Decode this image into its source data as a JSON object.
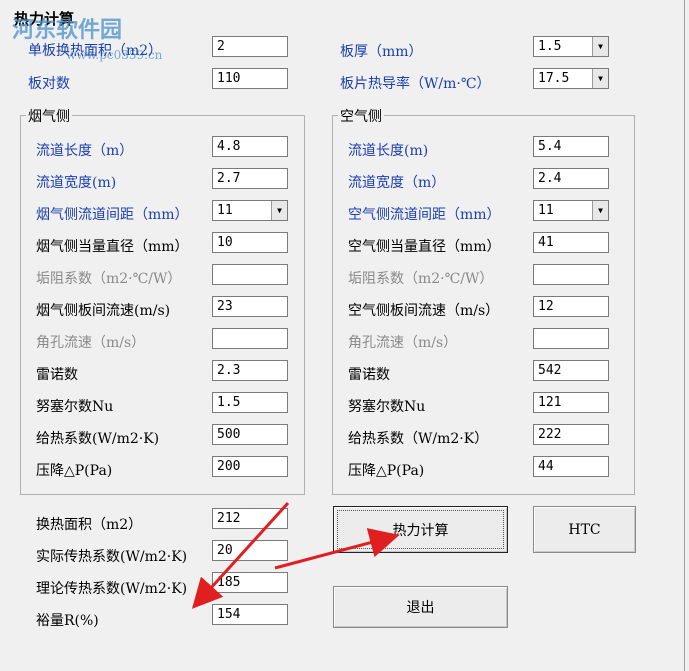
{
  "window": {
    "title": "热力计算"
  },
  "watermark": {
    "text": "河东软件园",
    "url": "www.pc0359.cn"
  },
  "top": {
    "area_label": "单板换热面积（m2）",
    "area_value": "2",
    "plates_label": "板对数",
    "plates_value": "110",
    "thickness_label": "板厚（mm）",
    "thickness_value": "1.5",
    "conductivity_label": "板片热导率（W/m·℃）",
    "conductivity_value": "17.5"
  },
  "flue": {
    "title": "烟气侧",
    "rows": [
      {
        "label": "流道长度（m）",
        "value": "4.8",
        "style": "blue"
      },
      {
        "label": "流道宽度(m)",
        "value": "2.7",
        "style": "blue"
      },
      {
        "label": "烟气侧流道间距（mm）",
        "value": "11",
        "style": "blue",
        "combo": true
      },
      {
        "label": "烟气侧当量直径（mm）",
        "value": "10",
        "style": "normal"
      },
      {
        "label": "垢阻系数（m2·℃/W）",
        "value": "",
        "style": "gray"
      },
      {
        "label": "烟气侧板间流速(m/s)",
        "value": "23",
        "style": "normal"
      },
      {
        "label": "角孔流速（m/s）",
        "value": "",
        "style": "gray"
      },
      {
        "label": "雷诺数",
        "value": "2.3",
        "style": "normal"
      },
      {
        "label": "努塞尔数Nu",
        "value": "1.5",
        "style": "normal"
      },
      {
        "label": "给热系数(W/m2·K)",
        "value": "500",
        "style": "normal"
      },
      {
        "label": "压降△P(Pa)",
        "value": "200",
        "style": "normal"
      }
    ]
  },
  "air": {
    "title": "空气侧",
    "rows": [
      {
        "label": "流道长度(m)",
        "value": "5.4",
        "style": "blue"
      },
      {
        "label": "流道宽度（m）",
        "value": "2.4",
        "style": "blue"
      },
      {
        "label": "空气侧流道间距（mm）",
        "value": "11",
        "style": "blue",
        "combo": true
      },
      {
        "label": "空气侧当量直径（mm）",
        "value": "41",
        "style": "normal"
      },
      {
        "label": "垢阻系数（m2·℃/W）",
        "value": "",
        "style": "gray"
      },
      {
        "label": "空气侧板间流速（m/s）",
        "value": "12",
        "style": "normal"
      },
      {
        "label": "角孔流速（m/s）",
        "value": "",
        "style": "gray"
      },
      {
        "label": "雷诺数",
        "value": "542",
        "style": "normal"
      },
      {
        "label": "努塞尔数Nu",
        "value": "121",
        "style": "normal"
      },
      {
        "label": "给热系数（W/m2·K）",
        "value": "222",
        "style": "normal"
      },
      {
        "label": "压降△P(Pa)",
        "value": "44",
        "style": "normal"
      }
    ]
  },
  "results": {
    "area_label": "换热面积（m2）",
    "area_value": "212",
    "actual_label": "实际传热系数(W/m2·K)",
    "actual_value": "20",
    "theory_label": "理论传热系数(W/m2·K)",
    "theory_value": "185",
    "margin_label": "裕量R(%)",
    "margin_value": "154"
  },
  "buttons": {
    "calc": "热力计算",
    "htc": "HTC",
    "exit": "退出"
  },
  "colors": {
    "label_blue": "#1a3fae",
    "label_gray": "#8a8a8a",
    "annotation_red": "#e02020"
  }
}
